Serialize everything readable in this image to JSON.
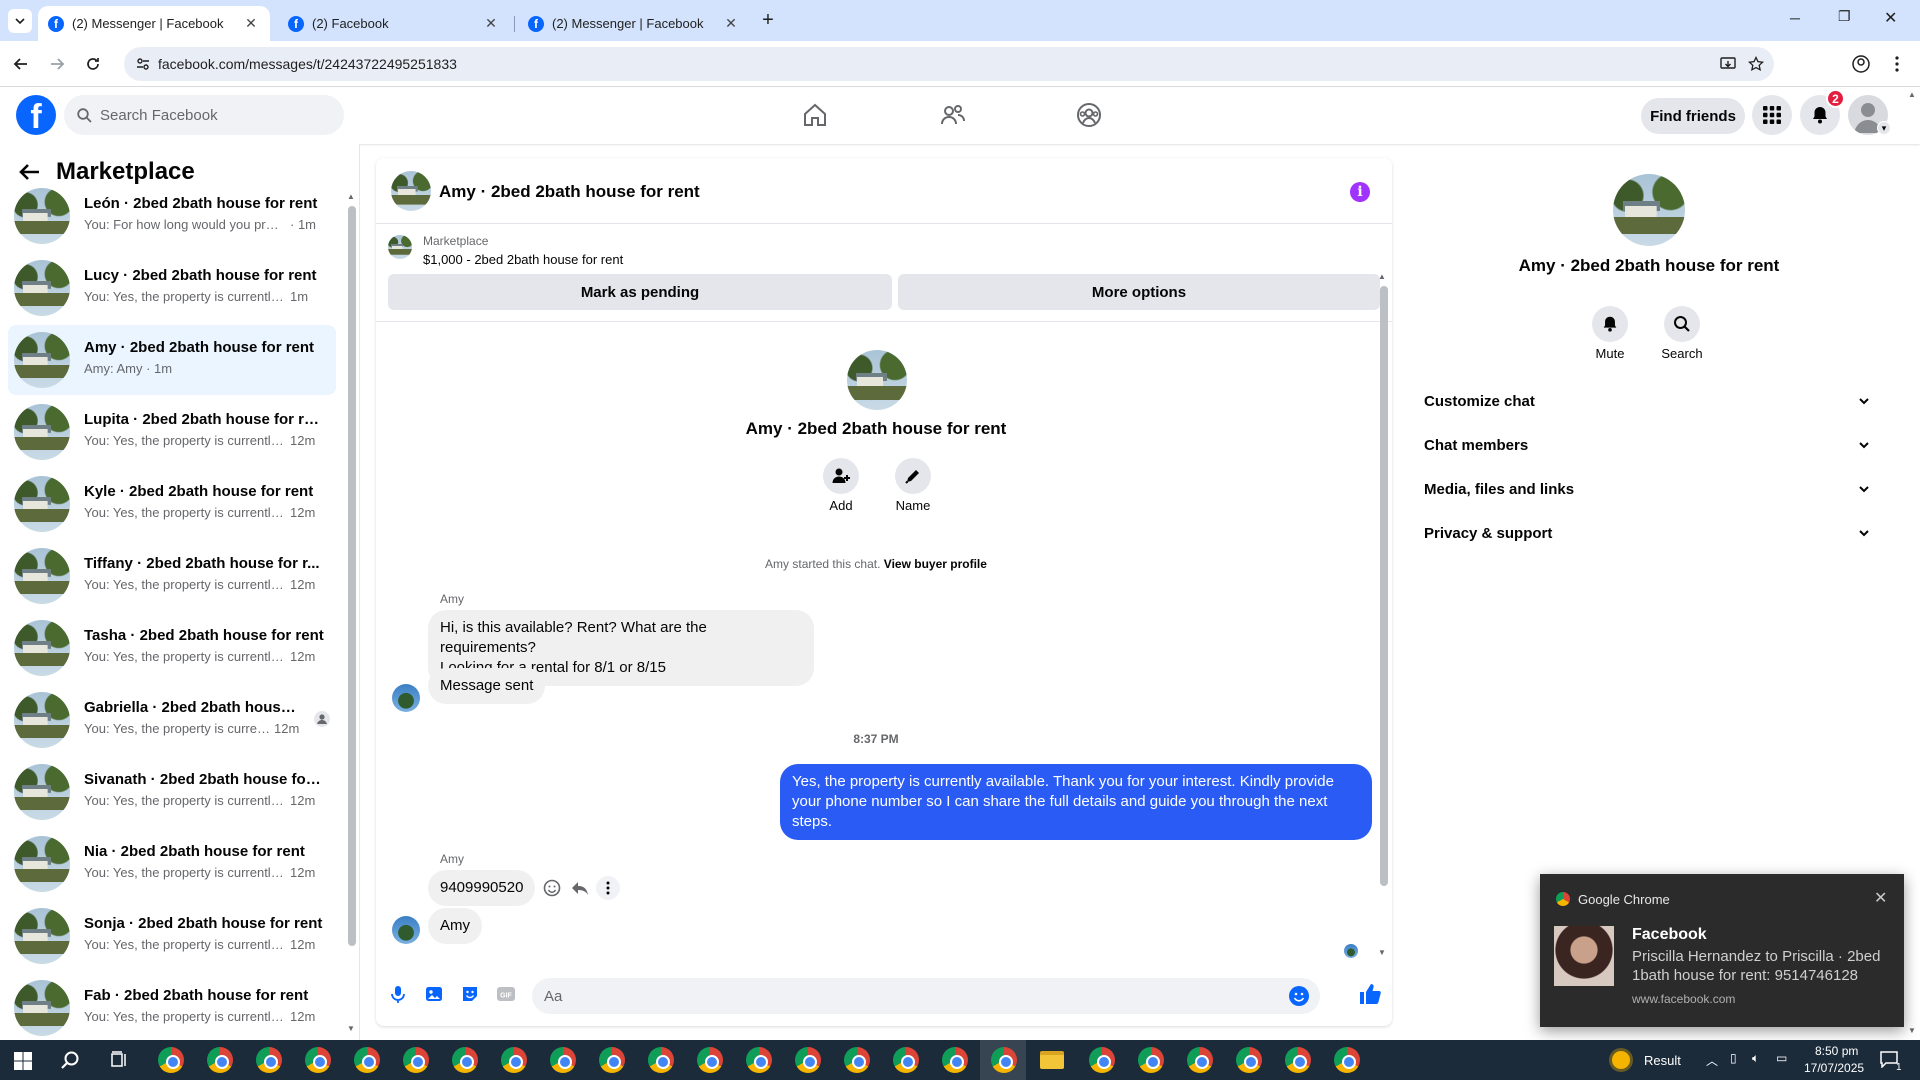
{
  "browser": {
    "tabs": [
      {
        "title": "(2) Messenger | Facebook"
      },
      {
        "title": "(2) Facebook"
      },
      {
        "title": "(2) Messenger | Facebook"
      }
    ],
    "url": "facebook.com/messages/t/24243722495251833"
  },
  "fb_header": {
    "search_placeholder": "Search Facebook",
    "find_friends_label": "Find friends",
    "notification_count": "2"
  },
  "sidebar": {
    "title": "Marketplace",
    "chats": [
      {
        "name": "León · 2bed 2bath house for rent",
        "preview": "You: For how long would you pref...",
        "time": "· 1m"
      },
      {
        "name": "Lucy · 2bed 2bath house for rent",
        "preview": "You: Yes, the property is currently a...",
        "time": "1m"
      },
      {
        "name": "Amy · 2bed 2bath house for rent",
        "preview": "Amy: Amy · 1m",
        "time": ""
      },
      {
        "name": "Lupita · 2bed 2bath house for rent",
        "preview": "You: Yes, the property is currently ...",
        "time": "12m"
      },
      {
        "name": "Kyle · 2bed 2bath house for rent",
        "preview": "You: Yes, the property is currently ...",
        "time": "12m"
      },
      {
        "name": "Tiffany · 2bed 2bath house for r...",
        "preview": "You: Yes, the property is currently ...",
        "time": "12m"
      },
      {
        "name": "Tasha · 2bed 2bath house for rent",
        "preview": "You: Yes, the property is currently ...",
        "time": "12m"
      },
      {
        "name": "Gabriella · 2bed 2bath house f...",
        "preview": "You: Yes, the property is curren...",
        "time": "12m"
      },
      {
        "name": "Sivanath · 2bed 2bath house for ...",
        "preview": "You: Yes, the property is currently ...",
        "time": "12m"
      },
      {
        "name": "Nia · 2bed 2bath house for rent",
        "preview": "You: Yes, the property is currently ...",
        "time": "12m"
      },
      {
        "name": "Sonja · 2bed 2bath house for rent",
        "preview": "You: Yes, the property is currently ...",
        "time": "12m"
      },
      {
        "name": "Fab · 2bed 2bath house for rent",
        "preview": "You: Yes, the property is currently ...",
        "time": "12m"
      }
    ]
  },
  "conversation": {
    "title": "Amy · 2bed 2bath house for rent",
    "marketplace_label": "Marketplace",
    "listing": "$1,000 - 2bed 2bath house for rent",
    "mark_pending": "Mark as pending",
    "more_options": "More options",
    "profile_name": "Amy · 2bed 2bath house for rent",
    "add_label": "Add",
    "name_label": "Name",
    "started_text": "Amy started this chat.",
    "view_buyer": "View buyer profile",
    "sender1": "Amy",
    "msg1_line1": "Hi, is this available? Rent? What are the requirements?",
    "msg1_line2": "Looking for a rental for 8/1 or 8/15",
    "msg2": "Message sent",
    "time_divider": "8:37 PM",
    "my_msg_line1": "Yes, the property is currently available. Thank you for your interest. Kindly provide",
    "my_msg_line2": "your phone number so I can share the full details and guide you through the next",
    "my_msg_line3": "steps.",
    "sender2": "Amy",
    "msg3": "9409990520",
    "msg4": "Amy",
    "input_placeholder": "Aa"
  },
  "info_panel": {
    "name": "Amy · 2bed 2bath house for rent",
    "mute_label": "Mute",
    "search_label": "Search",
    "sections": [
      {
        "label": "Customize chat"
      },
      {
        "label": "Chat members"
      },
      {
        "label": "Media, files and links"
      },
      {
        "label": "Privacy & support"
      }
    ]
  },
  "toast": {
    "app": "Google Chrome",
    "title": "Facebook",
    "line1": "Priscilla Hernandez to Priscilla · 2bed",
    "line2": "1bath house for rent: 9514746128",
    "source": "www.facebook.com"
  },
  "taskbar": {
    "weather": "Result",
    "time": "8:50 pm",
    "date": "17/07/2025",
    "notif_count": "1"
  },
  "colors": {
    "fb_blue": "#0866ff",
    "my_bubble": "#2a5cf5",
    "selected_chat": "#ebf5ff",
    "info_icon": "#a033ff"
  }
}
